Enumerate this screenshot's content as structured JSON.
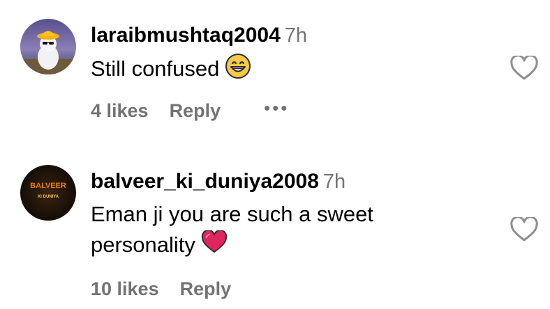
{
  "comments": [
    {
      "username": "laraibmushtaq2004",
      "time": "7h",
      "text": "Still confused",
      "emoji": "grinning-face-emoji",
      "likes": "4 likes",
      "reply": "Reply",
      "more_icon": "more-dots-icon",
      "avatar": "cat-with-bucket-hat-avatar"
    },
    {
      "username": "balveer_ki_duniya2008",
      "time": "7h",
      "text_line1": "Eman ji you are such a sweet",
      "text_line2": "personality",
      "emoji": "red-heart-emoji",
      "likes": "10 likes",
      "reply": "Reply",
      "avatar_title": "BALVEER",
      "avatar_subtitle": "KI DUNIYA"
    }
  ],
  "icons": {
    "like": "heart-outline-icon"
  },
  "colors": {
    "secondary_text": "#737373",
    "heart_outline": "#8e8e8e",
    "emoji_heart": "#e0245e",
    "emoji_face": "#f7c948"
  }
}
